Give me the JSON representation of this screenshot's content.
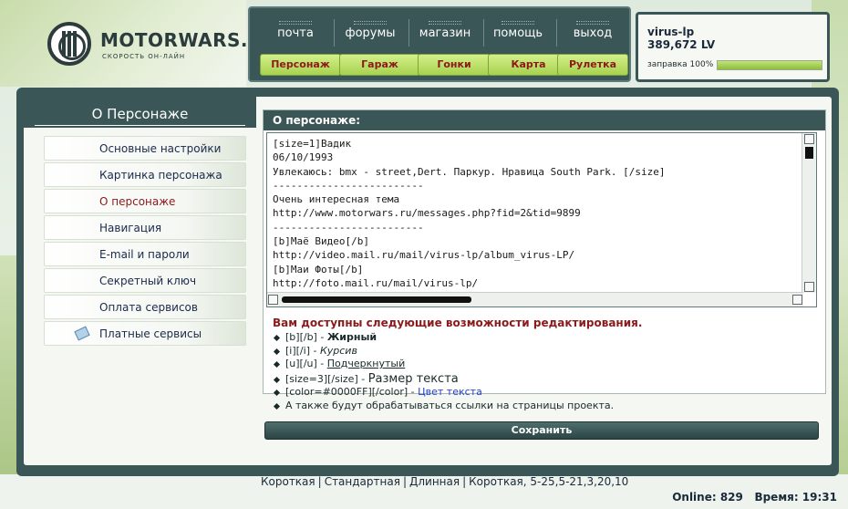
{
  "logo": {
    "title": "MOTORWARS.RU",
    "subtitle": "СКОРОСТЬ ОН-ЛАЙН"
  },
  "topnav": {
    "row1": [
      "почта",
      "форумы",
      "магазин",
      "помощь",
      "выход"
    ],
    "row2": [
      "Персонаж",
      "Гараж",
      "Гонки",
      "Карта",
      "Рулетка"
    ]
  },
  "user": {
    "name": "virus-lp",
    "balance": "389,672 LV",
    "fuel_label": "заправка 100%",
    "fuel_level": 1.0
  },
  "sidebar": {
    "title": "О Персонаже",
    "items": [
      {
        "label": "Основные настройки",
        "active": false
      },
      {
        "label": "Картинка персонажа",
        "active": false
      },
      {
        "label": "О персонаже",
        "active": true
      },
      {
        "label": "Навигация",
        "active": false
      },
      {
        "label": "E-mail и пароли",
        "active": false
      },
      {
        "label": "Секретный ключ",
        "active": false
      },
      {
        "label": "Оплата сервисов",
        "active": false
      },
      {
        "label": "Платные сервисы",
        "active": false,
        "icon": "money-icon"
      }
    ]
  },
  "panel": {
    "title": "О персонаже:",
    "editor_lines": [
      "[size=1]Вадик",
      "06/10/1993",
      "Увлекаюсь: bmx - street,Dert. Паркур. Нравица South Park. [/size]",
      "-------------------------",
      "Очень интересная тема",
      "http://www.motorwars.ru/messages.php?fid=2&tid=9899",
      "-------------------------",
      "[b]Маё Видео[/b]",
      "http://video.mail.ru/mail/virus-lp/album_virus-LP/",
      "[b]Маи Фоты[/b]",
      "http://foto.mail.ru/mail/virus-lp/"
    ],
    "help_title": "Вам доступны следующие возможности редактирования.",
    "help": {
      "bold_code": "[b][/b] - ",
      "bold_text": "Жирный",
      "italic_code": "[i][/i] - ",
      "italic_text": "Курсив",
      "underline_code": "[u][/u] - ",
      "underline_text": "Подчеркнутый",
      "size_code": "[size=3][/size] - ",
      "size_text": "Размер текста",
      "color_code": "[color=#0000FF][/color] - ",
      "color_text": "Цвет текста",
      "links_text": "А также будут обрабатываться ссылки на страницы проекта."
    },
    "save_label": "Сохранить"
  },
  "footer": {
    "links": [
      "Короткая",
      "Стандартная",
      "Длинная",
      "Короткая, 5-25,5-21,3,20,10"
    ],
    "online_label": "Online: 829",
    "time_label": "Время: 19:31"
  },
  "colors": {
    "frame": "#3b5656",
    "accent_green": "#a8d150",
    "active_text": "#8b1a1a"
  }
}
